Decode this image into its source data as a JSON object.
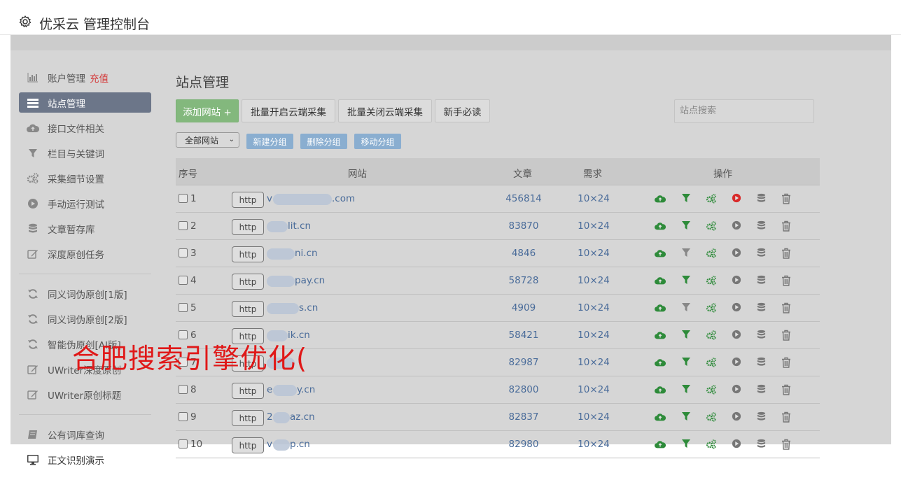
{
  "app": {
    "title": "优采云 管理控制台"
  },
  "sidebar": {
    "group1": [
      {
        "label": "账户管理",
        "extra": "充值",
        "icon": "bar-chart-icon"
      },
      {
        "label": "站点管理",
        "icon": "list-icon",
        "active": true
      },
      {
        "label": "接口文件相关",
        "icon": "cloud-upload-icon"
      },
      {
        "label": "栏目与关键词",
        "icon": "filter-icon"
      },
      {
        "label": "采集细节设置",
        "icon": "gears-icon"
      },
      {
        "label": "手动运行测试",
        "icon": "play-circle-icon"
      },
      {
        "label": "文章暂存库",
        "icon": "database-icon"
      },
      {
        "label": "深度原创任务",
        "icon": "edit-icon"
      }
    ],
    "group2": [
      {
        "label": "同义词伪原创[1版]",
        "icon": "refresh-icon"
      },
      {
        "label": "同义词伪原创[2版]",
        "icon": "refresh-icon"
      },
      {
        "label": "智能伪原创[AI版]",
        "icon": "refresh-icon"
      },
      {
        "label": "UWriter深度原创",
        "icon": "edit-icon"
      },
      {
        "label": "UWriter原创标题",
        "icon": "edit-icon"
      }
    ],
    "group3": [
      {
        "label": "公有词库查询",
        "icon": "book-icon"
      },
      {
        "label": "正文识别演示",
        "icon": "monitor-icon"
      }
    ]
  },
  "main": {
    "title": "站点管理",
    "buttons": {
      "add": "添加网站 +",
      "batch_on": "批量开启云端采集",
      "batch_off": "批量关闭云端采集",
      "guide": "新手必读"
    },
    "search_placeholder": "站点搜索",
    "group_select": "全部网站",
    "group_buttons": {
      "new": "新建分组",
      "delete": "删除分组",
      "move": "移动分组"
    }
  },
  "table": {
    "headers": {
      "no": "序号",
      "site": "网站",
      "articles": "文章",
      "demand": "需求",
      "ops": "操作"
    },
    "http_label": "http",
    "rows": [
      {
        "no": "1",
        "site_prefix": "v",
        "site_suffix": ".com",
        "articles": "456814",
        "demand": "10×24",
        "filter_active": true,
        "running": true
      },
      {
        "no": "2",
        "site_prefix": "",
        "site_suffix": "lit.cn",
        "articles": "83870",
        "demand": "10×24",
        "filter_active": true,
        "running": false
      },
      {
        "no": "3",
        "site_prefix": "",
        "site_suffix": "ni.cn",
        "articles": "4846",
        "demand": "10×24",
        "filter_active": false,
        "running": false
      },
      {
        "no": "4",
        "site_prefix": "",
        "site_suffix": "pay.cn",
        "articles": "58728",
        "demand": "10×24",
        "filter_active": true,
        "running": false
      },
      {
        "no": "5",
        "site_prefix": "",
        "site_suffix": "s.cn",
        "articles": "4909",
        "demand": "10×24",
        "filter_active": false,
        "running": false
      },
      {
        "no": "6",
        "site_prefix": "",
        "site_suffix": "ik.cn",
        "articles": "58421",
        "demand": "10×24",
        "filter_active": true,
        "running": false
      },
      {
        "no": "7",
        "site_prefix": "",
        "site_suffix": "",
        "articles": "82987",
        "demand": "10×24",
        "filter_active": true,
        "running": false
      },
      {
        "no": "8",
        "site_prefix": "e",
        "site_suffix": "y.cn",
        "articles": "82800",
        "demand": "10×24",
        "filter_active": true,
        "running": false
      },
      {
        "no": "9",
        "site_prefix": "2",
        "site_suffix": "az.cn",
        "articles": "82837",
        "demand": "10×24",
        "filter_active": true,
        "running": false
      },
      {
        "no": "10",
        "site_prefix": "v",
        "site_suffix": "p.cn",
        "articles": "82980",
        "demand": "10×24",
        "filter_active": true,
        "running": false
      }
    ]
  },
  "watermark": "合肥搜索引擎优化(",
  "colors": {
    "green": "#2e8b3a",
    "red": "#d92b2b",
    "link": "#4a6c9a",
    "active_nav": "#6c7689"
  }
}
